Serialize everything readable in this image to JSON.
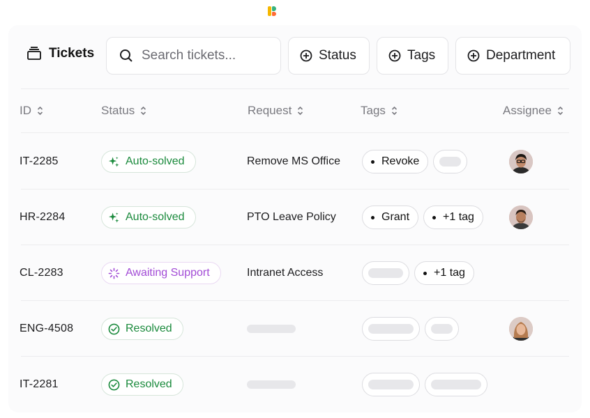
{
  "toolbar": {
    "title": "Tickets",
    "search_placeholder": "Search tickets...",
    "filters": [
      "Status",
      "Tags",
      "Department"
    ]
  },
  "columns": [
    "ID",
    "Status",
    "Request",
    "Tags",
    "Assignee"
  ],
  "rows": [
    {
      "id": "IT-2285",
      "status": "Auto-solved",
      "request": "Remove MS Office",
      "tags": [
        "Revoke"
      ]
    },
    {
      "id": "HR-2284",
      "status": "Auto-solved",
      "request": "PTO Leave Policy",
      "tags": [
        "Grant",
        "+1 tag"
      ]
    },
    {
      "id": "CL-2283",
      "status": "Awaiting Support",
      "request": "Intranet Access",
      "tags": [
        "+1 tag"
      ]
    },
    {
      "id": "ENG-4508",
      "status": "Resolved",
      "request": "",
      "tags": []
    },
    {
      "id": "IT-2281",
      "status": "Resolved",
      "request": "",
      "tags": []
    }
  ],
  "colors": {
    "auto_solved": "#1a8a3c",
    "awaiting_support": "#a24bd6",
    "resolved": "#1a8a3c"
  },
  "icons": {
    "title": "stacked-cards-icon",
    "search": "search-icon",
    "filter": "plus-circle-icon",
    "sort": "sort-icon",
    "auto_solved": "sparkle-icon",
    "awaiting": "spinner-icon",
    "resolved": "check-circle-icon"
  }
}
